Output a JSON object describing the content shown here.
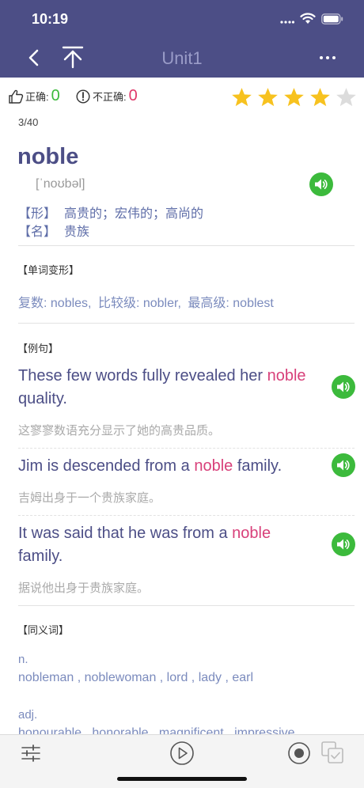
{
  "status": {
    "time": "10:19"
  },
  "nav": {
    "title": "Unit1"
  },
  "score": {
    "correct_label": "正确:",
    "correct_count": "0",
    "wrong_label": "不正确:",
    "wrong_count": "0",
    "rating": 4,
    "rating_max": 5
  },
  "progress": "3/40",
  "word": {
    "headword": "noble",
    "phonetic": "[ˈnoʊbəl]",
    "definitions": [
      {
        "pos": "【形】",
        "text": "高贵的；宏伟的；高尚的"
      },
      {
        "pos": "【名】",
        "text": "贵族"
      }
    ]
  },
  "forms": {
    "label": "【单词变形】",
    "plural_label": "复数:",
    "plural": "nobles,",
    "comparative_label": "比较级:",
    "comparative": "nobler,",
    "superlative_label": "最高级:",
    "superlative": "noblest"
  },
  "examples": {
    "label": "【例句】",
    "items": [
      {
        "before": "These few words fully revealed her ",
        "highlight": "noble",
        "after": " quality.",
        "translation": "这寥寥数语充分显示了她的高贵品质。"
      },
      {
        "before": "Jim is descended from a ",
        "highlight": "noble",
        "after": " family.",
        "translation": "吉姆出身于一个贵族家庭。"
      },
      {
        "before": "It was said that he was from a ",
        "highlight": "noble",
        "after": " family.",
        "translation": "据说他出身于贵族家庭。"
      }
    ]
  },
  "synonyms": {
    "label": "【同义词】",
    "groups": [
      {
        "pos": "n.",
        "words": "nobleman , noblewoman , lord , lady , earl"
      },
      {
        "pos": "adj.",
        "words": "honourable , honorable , magnificent , impressive"
      }
    ]
  },
  "colors": {
    "header": "#4c4e86",
    "accent_green": "#3cba3c",
    "highlight": "#d8407a",
    "star": "#f7c21f"
  },
  "icons": {
    "back": "chevron-left-icon",
    "up": "arrow-up-icon",
    "more": "more-icon",
    "speaker": "speaker-icon",
    "settings": "sliders-icon",
    "play": "play-icon",
    "record": "record-icon",
    "copy": "copy-icon"
  }
}
